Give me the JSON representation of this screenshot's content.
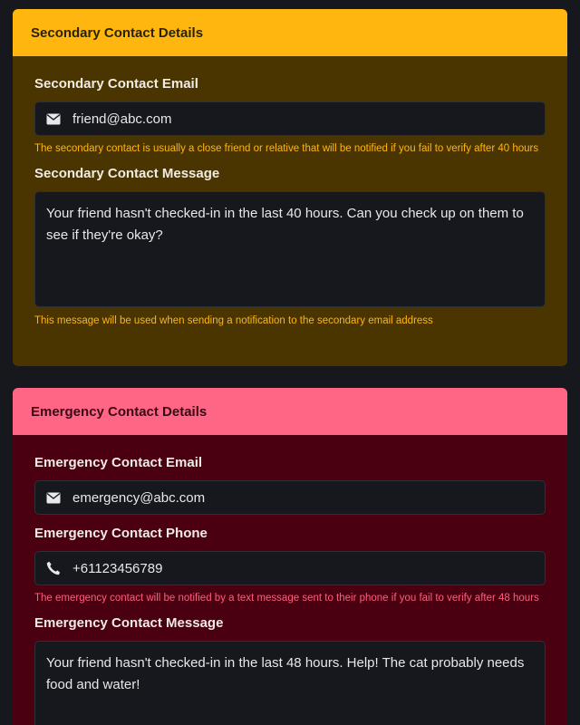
{
  "secondary": {
    "header": "Secondary Contact Details",
    "email_label": "Secondary Contact Email",
    "email_value": "friend@abc.com",
    "email_help": "The secondary contact is usually a close friend or relative that will be notified if you fail to verify after 40 hours",
    "message_label": "Secondary Contact Message",
    "message_value": "Your friend hasn't checked-in in the last 40 hours. Can you check up on them to see if they're okay?",
    "message_help": "This message will be used when sending a notification to the secondary email address"
  },
  "emergency": {
    "header": "Emergency Contact Details",
    "email_label": "Emergency Contact Email",
    "email_value": "emergency@abc.com",
    "phone_label": "Emergency Contact Phone",
    "phone_value": "+61123456789",
    "phone_help": "The emergency contact will be notified by a text message sent to their phone if you fail to verify after 48 hours",
    "message_label": "Emergency Contact Message",
    "message_value": "Your friend hasn't checked-in in the last 48 hours. Help! The cat probably needs food and water!"
  },
  "icons": {
    "email": "envelope-icon",
    "phone": "phone-icon"
  },
  "colors": {
    "secondary_accent": "#ffb60f",
    "secondary_body": "#4a3500",
    "emergency_accent": "#ff6584",
    "emergency_body": "#4a0010",
    "page_background": "#16181d"
  }
}
